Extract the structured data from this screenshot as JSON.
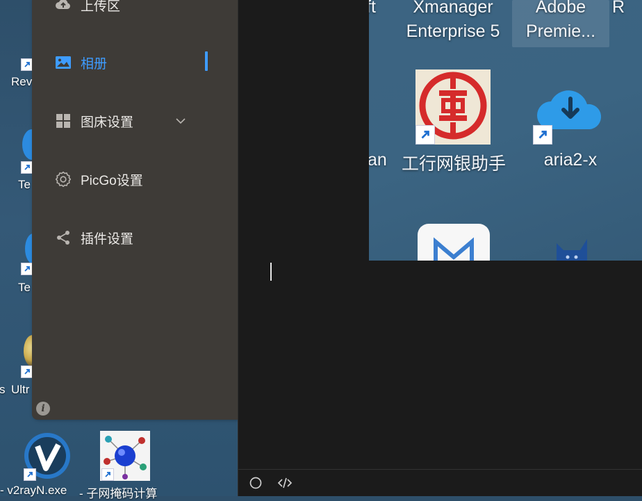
{
  "desktop_left": {
    "labels": [
      "Rev",
      "Te",
      "Te",
      "Ultr",
      "s"
    ]
  },
  "picgo": {
    "menu": [
      {
        "label": "上传区",
        "icon": "cloud-upload-icon"
      },
      {
        "label": "相册",
        "icon": "image-icon",
        "active": true
      },
      {
        "label": "图床设置",
        "icon": "grid-icon"
      },
      {
        "label": "PicGo设置",
        "icon": "gear-icon"
      },
      {
        "label": "插件设置",
        "icon": "share-icon"
      }
    ],
    "info_label": "i",
    "accent_color": "#3e9cff"
  },
  "desktop_window": {
    "icons": [
      {
        "label_line1": "ft",
        "label_line2": ""
      },
      {
        "label_line1": "Xmanager",
        "label_line2": "Enterprise 5"
      },
      {
        "label_line1": "Adobe",
        "label_line2": "Premie..."
      },
      {
        "label_line1": "R",
        "label_line2": ""
      },
      {
        "label": "an"
      },
      {
        "label": "工行网银助手"
      },
      {
        "label": "aria2-x"
      }
    ]
  },
  "desktop_bottom": {
    "labels": [
      "- v2rayN.exe",
      "- 子网掩码计算"
    ]
  },
  "editor": {
    "status_icons": [
      "circle-icon",
      "code-icon"
    ]
  }
}
